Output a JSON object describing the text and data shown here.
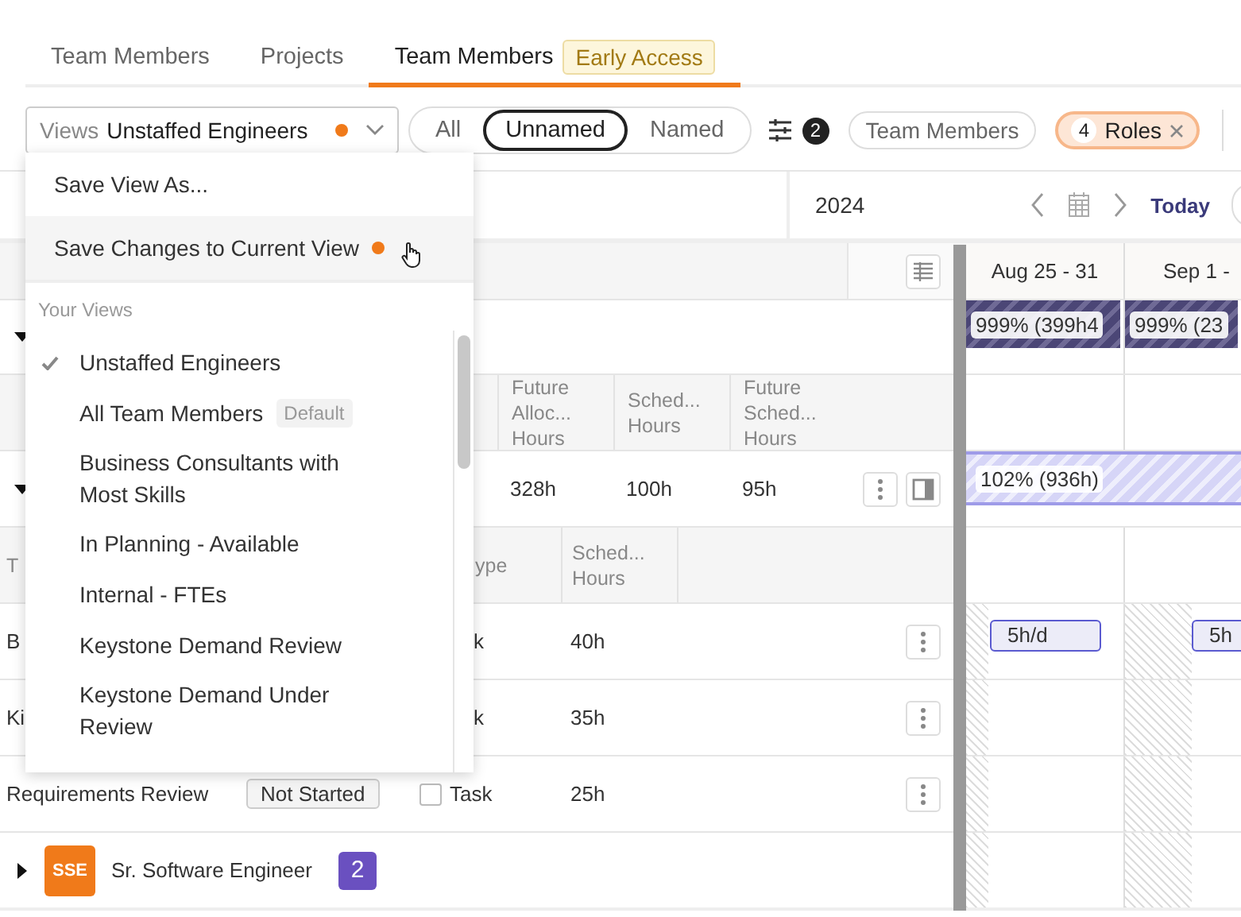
{
  "tabs": [
    {
      "label": "Team Members",
      "selected": false
    },
    {
      "label": "Projects",
      "selected": false
    },
    {
      "label": "Team Members",
      "badge": "Early Access",
      "selected": true
    }
  ],
  "toolbar": {
    "views_select": {
      "label": "Views",
      "value": "Unstaffed Engineers",
      "unsaved": true
    },
    "segments": [
      {
        "label": "All",
        "selected": false
      },
      {
        "label": "Unnamed",
        "selected": true
      },
      {
        "label": "Named",
        "selected": false
      }
    ],
    "filter_count": "2",
    "chips": [
      {
        "label": "Team Members",
        "selected": false
      },
      {
        "count": "4",
        "label": "Roles",
        "selected": true
      }
    ]
  },
  "views_menu": {
    "actions": [
      {
        "label": "Save View As...",
        "hovered": false,
        "unsaved": false
      },
      {
        "label": "Save Changes to Current View",
        "hovered": true,
        "unsaved": true
      }
    ],
    "section_title": "Your Views",
    "items": [
      {
        "label": "Unstaffed Engineers",
        "selected": true
      },
      {
        "label": "All Team Members",
        "badge": "Default",
        "selected": false
      },
      {
        "label": "Business Consultants with Most Skills",
        "selected": false
      },
      {
        "label": "In Planning - Available",
        "selected": false
      },
      {
        "label": "Internal - FTEs",
        "selected": false
      },
      {
        "label": "Keystone Demand Review",
        "selected": false
      },
      {
        "label": "Keystone Demand Under Review",
        "selected": false
      }
    ]
  },
  "timeline": {
    "year": "2024",
    "today": "Today",
    "weeks": [
      "Aug 25 - 31",
      "Sep 1 -"
    ]
  },
  "rows": [
    {
      "kind": "group",
      "expanded": true,
      "bars": [
        "999% (399h4",
        "999% (23"
      ]
    },
    {
      "kind": "header",
      "cells": [
        "Future Alloc... Hours",
        "Sched... Hours",
        "Future Sched... Hours"
      ]
    },
    {
      "kind": "summary",
      "expanded": true,
      "cells": [
        "328h",
        "100h",
        "95h"
      ],
      "bar": "102% (936h)"
    },
    {
      "kind": "task_header",
      "name": "T",
      "type": "ype",
      "hours": "Sched... Hours"
    },
    {
      "kind": "task",
      "name": "B",
      "type": "k",
      "hours": "40h",
      "allocations": [
        "5h/d",
        "5h"
      ]
    },
    {
      "kind": "task",
      "name": "Ki",
      "type": "k",
      "hours": "35h",
      "allocations": []
    },
    {
      "kind": "task",
      "name": "Requirements Review",
      "status": "Not Started",
      "type": "Task",
      "checked": false,
      "hours": "25h",
      "allocations": []
    },
    {
      "kind": "role",
      "expanded": false,
      "initials": "SSE",
      "name": "Sr. Software Engineer",
      "count": "2"
    }
  ]
}
